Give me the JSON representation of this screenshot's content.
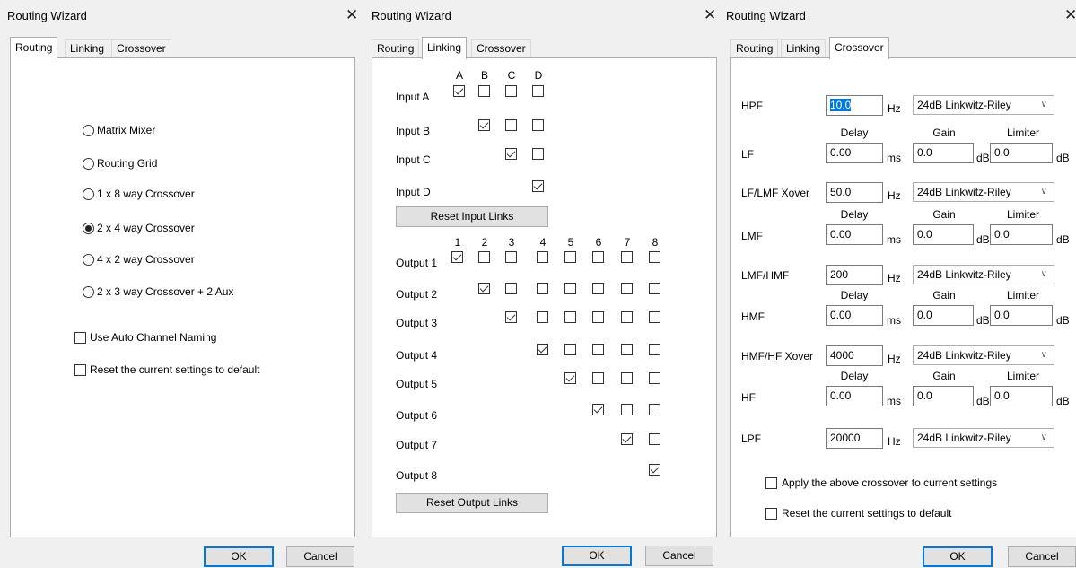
{
  "dialogs": [
    {
      "title": "Routing Wizard",
      "tabs": [
        "Routing",
        "Linking",
        "Crossover"
      ],
      "options": [
        "Matrix Mixer",
        "Routing Grid",
        "1 x 8 way Crossover",
        "2 x 4 way Crossover",
        "4 x 2 way Crossover",
        "2 x 3 way Crossover + 2 Aux"
      ],
      "selected_option": "2 x 4 way Crossover",
      "auto_naming_label": "Use Auto Channel Naming",
      "reset_label": "Reset the current settings to default",
      "ok": "OK",
      "cancel": "Cancel"
    },
    {
      "title": "Routing Wizard",
      "tabs": [
        "Routing",
        "Linking",
        "Crossover"
      ],
      "input_cols": [
        "A",
        "B",
        "C",
        "D"
      ],
      "input_rows": [
        "Input A",
        "Input B",
        "Input C",
        "Input D"
      ],
      "reset_input_links": "Reset Input Links",
      "output_cols": [
        "1",
        "2",
        "3",
        "4",
        "5",
        "6",
        "7",
        "8"
      ],
      "output_rows": [
        "Output 1",
        "Output 2",
        "Output 3",
        "Output 4",
        "Output 5",
        "Output 6",
        "Output 7",
        "Output 8"
      ],
      "reset_output_links": "Reset Output Links",
      "ok": "OK",
      "cancel": "Cancel"
    },
    {
      "title": "Routing Wizard",
      "tabs": [
        "Routing",
        "Linking",
        "Crossover"
      ],
      "filters": [
        {
          "label": "HPF",
          "value": "10.0",
          "unit": "Hz",
          "slope": "24dB Linkwitz-Riley"
        },
        {
          "label": "LF/LMF Xover",
          "value": "50.0",
          "unit": "Hz",
          "slope": "24dB Linkwitz-Riley"
        },
        {
          "label": "LMF/HMF",
          "value": "200",
          "unit": "Hz",
          "slope": "24dB Linkwitz-Riley"
        },
        {
          "label": "HMF/HF Xover",
          "value": "4000",
          "unit": "Hz",
          "slope": "24dB Linkwitz-Riley"
        },
        {
          "label": "LPF",
          "value": "20000",
          "unit": "Hz",
          "slope": "24dB Linkwitz-Riley"
        }
      ],
      "bands": [
        {
          "label": "LF",
          "delay": "0.00",
          "gain": "0.0",
          "limiter": "0.0"
        },
        {
          "label": "LMF",
          "delay": "0.00",
          "gain": "0.0",
          "limiter": "0.0"
        },
        {
          "label": "HMF",
          "delay": "0.00",
          "gain": "0.0",
          "limiter": "0.0"
        },
        {
          "label": "HF",
          "delay": "0.00",
          "gain": "0.0",
          "limiter": "0.0"
        }
      ],
      "headers": {
        "delay": "Delay",
        "gain": "Gain",
        "limiter": "Limiter"
      },
      "units": {
        "delay": "ms",
        "gain": "dB",
        "limiter": "dB"
      },
      "apply_label": "Apply the above crossover to current settings",
      "reset_label": "Reset the current settings to default",
      "ok": "OK",
      "cancel": "Cancel"
    }
  ]
}
